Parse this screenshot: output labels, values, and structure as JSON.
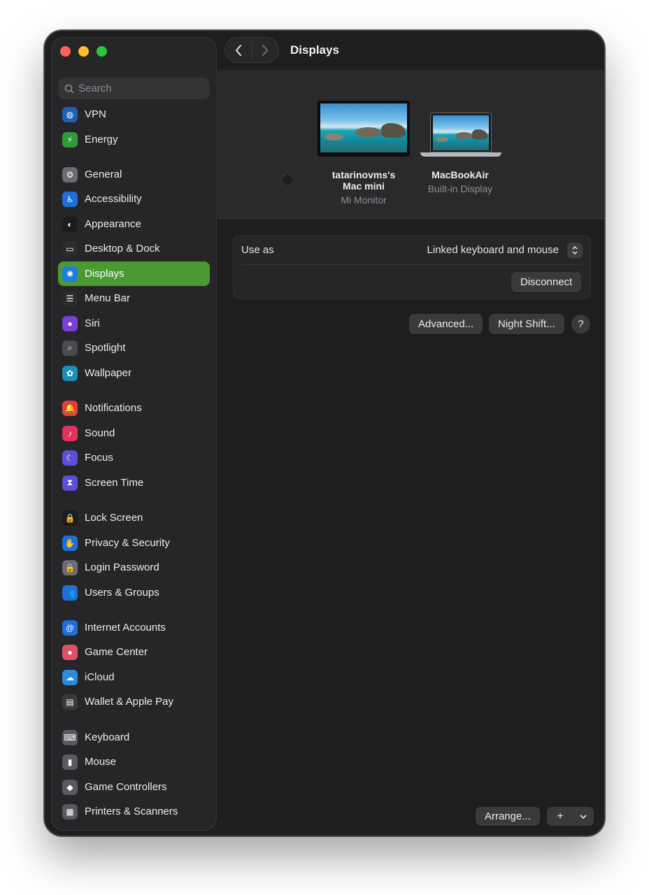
{
  "window": {
    "title": "Displays"
  },
  "sidebar": {
    "search_placeholder": "Search",
    "items": [
      {
        "label": "VPN",
        "icon": "globe-icon",
        "color": "#1e5fb8"
      },
      {
        "label": "Energy",
        "icon": "bolt-icon",
        "color": "#2f9a3a"
      },
      {
        "label": "General",
        "icon": "gear-icon",
        "color": "#6b6b70"
      },
      {
        "label": "Accessibility",
        "icon": "accessibility-icon",
        "color": "#1e6fd9"
      },
      {
        "label": "Appearance",
        "icon": "appearance-icon",
        "color": "#1c1c1e"
      },
      {
        "label": "Desktop & Dock",
        "icon": "dock-icon",
        "color": "#2c2c2e"
      },
      {
        "label": "Displays",
        "icon": "sun-icon",
        "color": "#1e7be0",
        "active": true
      },
      {
        "label": "Menu Bar",
        "icon": "menubar-icon",
        "color": "#2c2c2e"
      },
      {
        "label": "Siri",
        "icon": "siri-icon",
        "color": "#7a3fd6"
      },
      {
        "label": "Spotlight",
        "icon": "magnifier-icon",
        "color": "#4a4a50"
      },
      {
        "label": "Wallpaper",
        "icon": "flower-icon",
        "color": "#1a8fb8"
      },
      {
        "label": "Notifications",
        "icon": "bell-icon",
        "color": "#e0403c"
      },
      {
        "label": "Sound",
        "icon": "speaker-icon",
        "color": "#e0335c"
      },
      {
        "label": "Focus",
        "icon": "moon-icon",
        "color": "#5a4fd6"
      },
      {
        "label": "Screen Time",
        "icon": "hourglass-icon",
        "color": "#5a4fd6"
      },
      {
        "label": "Lock Screen",
        "icon": "lock-icon",
        "color": "#1c1c1e"
      },
      {
        "label": "Privacy & Security",
        "icon": "hand-icon",
        "color": "#1e6fd9"
      },
      {
        "label": "Login Password",
        "icon": "padlock-icon",
        "color": "#6b6b70"
      },
      {
        "label": "Users & Groups",
        "icon": "users-icon",
        "color": "#1e6fd9"
      },
      {
        "label": "Internet Accounts",
        "icon": "at-icon",
        "color": "#1e6fd9"
      },
      {
        "label": "Game Center",
        "icon": "gamecenter-icon",
        "color": "#e0506a"
      },
      {
        "label": "iCloud",
        "icon": "cloud-icon",
        "color": "#2a8ae0"
      },
      {
        "label": "Wallet & Apple Pay",
        "icon": "wallet-icon",
        "color": "#3a3a3c"
      },
      {
        "label": "Keyboard",
        "icon": "keyboard-icon",
        "color": "#5a5a5e"
      },
      {
        "label": "Mouse",
        "icon": "mouse-icon",
        "color": "#5a5a5e"
      },
      {
        "label": "Game Controllers",
        "icon": "gamepad-icon",
        "color": "#5a5a5e"
      },
      {
        "label": "Printers & Scanners",
        "icon": "printer-icon",
        "color": "#5a5a5e"
      }
    ]
  },
  "displays": [
    {
      "name": "tatarinovms's",
      "name2": "Mac mini",
      "subtitle": "Mi Monitor"
    },
    {
      "name": "MacBookAir",
      "name2": "",
      "subtitle": "Built-in Display"
    }
  ],
  "settings": {
    "use_as_label": "Use as",
    "use_as_value": "Linked keyboard and mouse",
    "disconnect": "Disconnect"
  },
  "buttons": {
    "advanced": "Advanced...",
    "night_shift": "Night Shift...",
    "help": "?",
    "arrange": "Arrange...",
    "add": "+",
    "more": "⌄"
  }
}
